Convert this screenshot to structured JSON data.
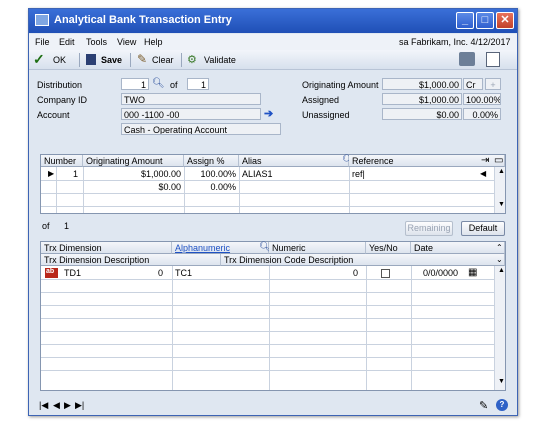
{
  "window": {
    "title": "Analytical Bank Transaction Entry"
  },
  "menu": {
    "file": "File",
    "edit": "Edit",
    "tools": "Tools",
    "view": "View",
    "help": "Help",
    "user_info": "sa  Fabrikam, Inc.  4/12/2017"
  },
  "toolbar": {
    "ok": "OK",
    "save": "Save",
    "clear": "Clear",
    "validate": "Validate"
  },
  "header": {
    "distribution_label": "Distribution",
    "distribution_value": "1",
    "of_label": "of",
    "of_value": "1",
    "company_label": "Company ID",
    "company_value": "TWO",
    "account_label": "Account",
    "account_value": "000 -1100 -00",
    "account_desc": "Cash - Operating Account",
    "orig_amount_label": "Originating Amount",
    "orig_amount_value": "$1,000.00",
    "orig_amount_type": "Cr",
    "assigned_label": "Assigned",
    "assigned_value": "$1,000.00",
    "assigned_pct": "100.00%",
    "unassigned_label": "Unassigned",
    "unassigned_value": "$0.00",
    "unassigned_pct": "0.00%"
  },
  "grid1": {
    "columns": [
      "Number",
      "Originating Amount",
      "Assign %",
      "Alias",
      "Reference"
    ],
    "rows": [
      {
        "number": "1",
        "amount": "$1,000.00",
        "assign": "100.00%",
        "alias": "ALIAS1",
        "reference": "ref|"
      },
      {
        "number": "",
        "amount": "$0.00",
        "assign": "0.00%",
        "alias": "",
        "reference": ""
      }
    ],
    "footer_of": "of",
    "footer_count": "1",
    "remaining_btn": "Remaining",
    "default_btn": "Default"
  },
  "grid2": {
    "columns": {
      "trx_dimension": "Trx Dimension",
      "alphanumeric": "Alphanumeric",
      "numeric": "Numeric",
      "yes_no": "Yes/No",
      "date": "Date",
      "trx_dim_desc": "Trx Dimension Description",
      "trx_dim_code_desc": "Trx Dimension Code Description"
    },
    "rows": [
      {
        "icon": "ab",
        "dimension": "TD1",
        "numeric_left": "0",
        "code": "TC1",
        "numeric": "0",
        "date": "0/0/0000"
      }
    ]
  },
  "colors": {
    "title": "#2a5cc8",
    "window_bg": "#dfe7f1"
  }
}
